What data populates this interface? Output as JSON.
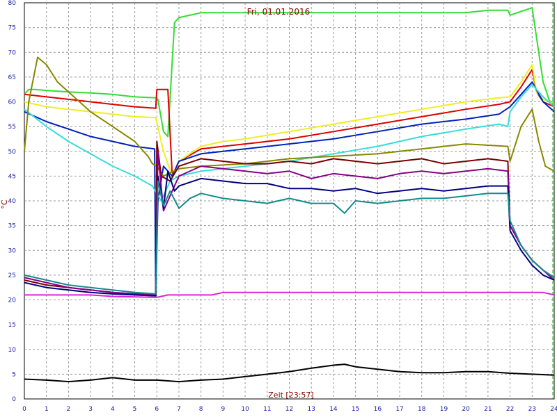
{
  "chart_data": {
    "type": "line",
    "title": "Fri, 01.01.2016",
    "xlabel": "Zeit [23:57]",
    "ylabel": "°C",
    "xlim": [
      0,
      24
    ],
    "ylim": [
      0,
      80
    ],
    "xticks": [
      "0",
      "1",
      "2",
      "3",
      "4",
      "5",
      "6",
      "7",
      "8",
      "9",
      "10",
      "11",
      "12",
      "13",
      "14",
      "15",
      "16",
      "17",
      "18",
      "19",
      "20",
      "21",
      "22",
      "23",
      "24"
    ],
    "yticks": [
      "0",
      "5",
      "10",
      "15",
      "20",
      "25",
      "30",
      "35",
      "40",
      "45",
      "50",
      "55",
      "60",
      "65",
      "70",
      "75",
      "80"
    ],
    "grid": true,
    "series": [
      {
        "color": "#33dd33",
        "x": [
          0,
          0.2,
          0.5,
          1,
          2,
          3,
          4,
          5,
          5.95,
          6.05,
          6.3,
          6.5,
          6.8,
          7,
          8,
          12,
          16,
          20,
          21,
          21.9,
          22,
          23,
          23.2,
          23.5,
          23.8,
          24
        ],
        "y": [
          61.5,
          62.5,
          62.5,
          62.3,
          62,
          61.8,
          61.5,
          61,
          60.8,
          60.5,
          54,
          53,
          76,
          77,
          78,
          78,
          78,
          78,
          78.5,
          78.5,
          77.5,
          79,
          73,
          64,
          60,
          60
        ]
      },
      {
        "color": "#dd0000",
        "x": [
          0,
          1,
          2,
          3,
          4,
          5,
          5.95,
          6,
          6.5,
          6.7,
          7,
          8,
          9,
          10,
          12,
          14,
          16,
          18,
          20,
          21.5,
          22,
          22.5,
          23,
          23.2,
          23.5,
          24
        ],
        "y": [
          61.5,
          61,
          60.5,
          60,
          59.5,
          59,
          58.7,
          62.5,
          62.5,
          45,
          48,
          50.5,
          51,
          51.5,
          52.5,
          54,
          55.5,
          57,
          58.5,
          59.5,
          60,
          63,
          66.5,
          62,
          60,
          59
        ]
      },
      {
        "color": "#eeee22",
        "x": [
          0,
          1,
          2,
          3,
          4,
          5,
          5.95,
          6.3,
          6.7,
          7,
          8,
          9,
          10,
          12,
          14,
          16,
          18,
          20,
          21.5,
          22,
          22.5,
          23,
          23.2,
          23.5,
          24
        ],
        "y": [
          60,
          59,
          58.5,
          58,
          57.5,
          57,
          56.8,
          50,
          45,
          48,
          51,
          52,
          52.5,
          54,
          55.5,
          57,
          58.5,
          60,
          60.8,
          61,
          64,
          67.5,
          62,
          60.5,
          59.5
        ]
      },
      {
        "color": "#0022bb",
        "x": [
          0,
          0.5,
          1,
          2,
          3,
          4,
          5,
          5.9,
          5.95,
          6.05,
          6.3,
          6.7,
          7,
          8,
          9,
          10,
          12,
          14,
          16,
          18,
          20,
          21.5,
          22,
          22.5,
          23,
          23.5,
          24
        ],
        "y": [
          58,
          57,
          56,
          54.5,
          53,
          52,
          51,
          50.5,
          21,
          40,
          47,
          45,
          48,
          49.5,
          50,
          50.5,
          51.5,
          52.5,
          54,
          55.5,
          56.5,
          57.5,
          59,
          61.5,
          64,
          60,
          58
        ]
      },
      {
        "color": "#33dddd",
        "x": [
          0,
          1,
          2,
          3,
          4,
          5,
          5.8,
          6.2,
          6.6,
          7,
          8,
          9,
          10,
          12,
          14,
          16,
          18,
          20,
          21.5,
          21.9,
          22,
          22.5,
          23,
          23.5,
          24
        ],
        "y": [
          58.5,
          55,
          52,
          49.5,
          47,
          45,
          43,
          40,
          44,
          45,
          46,
          46.5,
          47,
          48,
          49.5,
          51,
          53,
          54.5,
          55.5,
          55,
          58,
          61,
          63.5,
          61,
          59
        ]
      },
      {
        "color": "#888800",
        "x": [
          0,
          0.2,
          0.6,
          1,
          1.5,
          2,
          3,
          4,
          5,
          5.6,
          5.8,
          6,
          6.3,
          7,
          8,
          10,
          12,
          14,
          16,
          18,
          20,
          21.9,
          22,
          22.5,
          23,
          23.3,
          23.6,
          24
        ],
        "y": [
          50,
          60,
          69,
          67.5,
          64,
          62,
          58,
          55,
          52,
          49,
          47.5,
          47,
          45,
          46.5,
          47,
          47.5,
          48.5,
          49,
          49.5,
          50.5,
          51.5,
          51,
          48,
          55,
          58.5,
          52,
          47,
          46
        ]
      },
      {
        "color": "#7a0000",
        "x": [
          0,
          1,
          2,
          3,
          4,
          5,
          5.95,
          6.0,
          6.2,
          6.6,
          7,
          8,
          9,
          10,
          11,
          12,
          13,
          14,
          15,
          16,
          17,
          18,
          19,
          20,
          21,
          21.9,
          22,
          22.5,
          23,
          23.5,
          24
        ],
        "y": [
          24,
          23,
          22.5,
          22,
          21.5,
          21.2,
          21,
          52,
          45,
          44,
          47,
          48.5,
          48,
          47.5,
          47.5,
          48,
          47.5,
          48.5,
          48,
          47.5,
          48,
          48.5,
          47.5,
          48,
          48.5,
          48,
          35,
          31,
          28,
          26,
          24.5
        ]
      },
      {
        "color": "#880088",
        "x": [
          0,
          1,
          2,
          3,
          4,
          5,
          5.95,
          6.05,
          6.3,
          6.7,
          7,
          8,
          9,
          10,
          11,
          12,
          13,
          14,
          15,
          16,
          17,
          18,
          19,
          20,
          21,
          21.9,
          22,
          22.5,
          23,
          23.5,
          24
        ],
        "y": [
          24.5,
          23.5,
          22.5,
          22,
          21.5,
          21.2,
          21,
          50,
          38,
          42,
          45,
          47,
          46.5,
          46,
          45.5,
          46,
          44.5,
          45.5,
          45,
          44.5,
          45.5,
          46,
          45.5,
          46,
          46.5,
          46,
          35,
          31,
          28,
          26,
          24
        ]
      },
      {
        "color": "#000080",
        "x": [
          0,
          1,
          2,
          3,
          4,
          5,
          5.95,
          6.05,
          6.3,
          6.5,
          6.8,
          7,
          8,
          9,
          10,
          11,
          12,
          13,
          14,
          15,
          16,
          17,
          18,
          19,
          20,
          21,
          21.9,
          22,
          22.5,
          23,
          23.5,
          24
        ],
        "y": [
          23.5,
          22.5,
          22,
          21.5,
          21.2,
          21,
          20.8,
          45,
          38.5,
          46,
          42,
          43,
          44.5,
          44,
          43.5,
          43.5,
          42.5,
          42.5,
          42,
          42.5,
          41.5,
          42,
          42.5,
          42,
          42.5,
          43,
          43,
          34,
          30,
          27,
          25,
          24
        ]
      },
      {
        "color": "#138b8b",
        "x": [
          0,
          1,
          2,
          3,
          4,
          5,
          5.95,
          6.05,
          6.3,
          6.6,
          7,
          7.5,
          8,
          9,
          10,
          11,
          12,
          13,
          14,
          14.5,
          15,
          16,
          17,
          18,
          19,
          20,
          21,
          21.9,
          22,
          22.5,
          23,
          23.5,
          24
        ],
        "y": [
          25,
          24,
          23,
          22.5,
          22,
          21.5,
          21.2,
          44,
          39,
          42,
          38.5,
          40.5,
          41.5,
          40.5,
          40,
          39.5,
          40.5,
          39.5,
          39.5,
          37.5,
          40,
          39.5,
          40,
          40.5,
          40.5,
          41,
          41.5,
          41.5,
          36,
          31,
          28,
          26,
          24.5
        ]
      },
      {
        "color": "#dd22dd",
        "x": [
          0,
          3,
          4,
          6,
          6.5,
          8.5,
          9,
          12,
          16,
          20,
          23.5,
          24
        ],
        "y": [
          21,
          21,
          20.7,
          20.5,
          21,
          21,
          21.5,
          21.5,
          21.5,
          21.5,
          21.5,
          21
        ]
      },
      {
        "color": "#000000",
        "x": [
          0,
          1,
          2,
          3,
          4,
          5,
          6,
          7,
          8,
          9,
          10,
          11,
          12,
          13,
          14,
          14.5,
          15,
          16,
          17,
          18,
          19,
          20,
          21,
          22,
          23,
          24
        ],
        "y": [
          4,
          3.8,
          3.5,
          3.8,
          4.3,
          3.8,
          3.8,
          3.5,
          3.8,
          4,
          4.5,
          5,
          5.5,
          6.2,
          6.8,
          7,
          6.5,
          6,
          5.5,
          5.3,
          5.3,
          5.5,
          5.5,
          5.2,
          5,
          4.8
        ]
      }
    ]
  }
}
